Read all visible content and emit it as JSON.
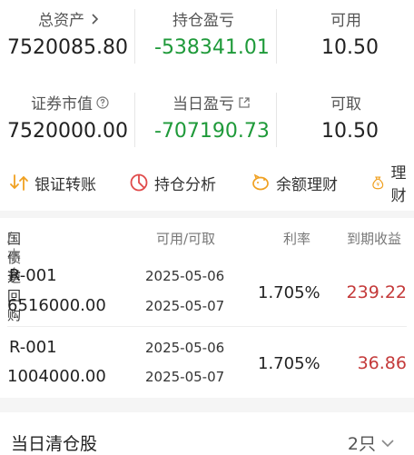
{
  "summary_row1": [
    {
      "label": "总资产",
      "value": "7520085.80",
      "has_chevron": true
    },
    {
      "label": "持仓盈亏",
      "value": "-538341.01",
      "color": "#1f9a3a"
    },
    {
      "label": "可用",
      "value": "10.50"
    }
  ],
  "summary_row2": [
    {
      "label": "证券市值",
      "value": "7520000.00",
      "has_help": true
    },
    {
      "label": "当日盈亏",
      "value": "-707190.73",
      "color": "#1f9a3a",
      "has_link": true
    },
    {
      "label": "可取",
      "value": "10.50"
    }
  ],
  "shortcuts": [
    {
      "label": "银证转账",
      "icon": "transfer-icon"
    },
    {
      "label": "持仓分析",
      "icon": "pie-analysis-icon"
    },
    {
      "label": "余额理财",
      "icon": "piggy-bank-icon"
    },
    {
      "label": "理财",
      "icon": "money-bag-icon"
    }
  ],
  "table": {
    "headers": {
      "col1_main": "国债逆回购",
      "col1_sub": "/本金",
      "col2": "可用/可取",
      "col3": "利率",
      "col4": "到期收益"
    },
    "rows": [
      {
        "code": "R-001",
        "principal": "6516000.00",
        "date1": "2025-05-06",
        "date2": "2025-05-07",
        "rate": "1.705%",
        "yield": "239.22"
      },
      {
        "code": "R-001",
        "principal": "1004000.00",
        "date1": "2025-05-06",
        "date2": "2025-05-07",
        "rate": "1.705%",
        "yield": "36.86"
      }
    ]
  },
  "footer": {
    "title": "当日清仓股",
    "count": "2只"
  },
  "colors": {
    "loss_green": "#1f9a3a",
    "gain_red": "#c43a3a",
    "accent_orange": "#f0a020"
  }
}
